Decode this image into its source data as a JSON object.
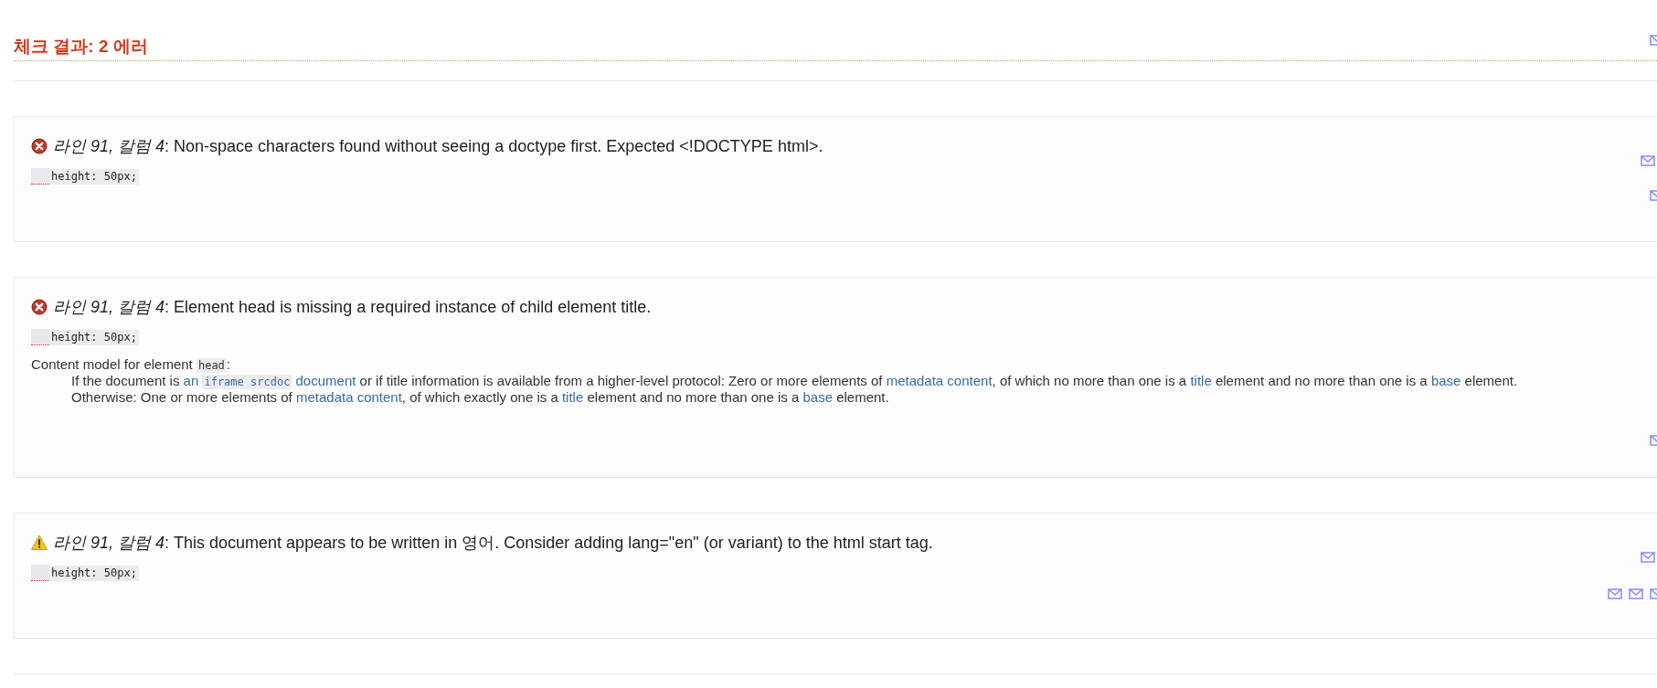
{
  "heading": "체크 결과: 2 에러",
  "messages": [
    {
      "kind": "error",
      "text": "*라인 91, 칼럼 4*: Non-space characters found without seeing a doctype first. Expected <!DOCTYPE html>.",
      "code": "height: 50px;"
    },
    {
      "kind": "error",
      "text": "*라인 91, 칼럼 4*: Element head is missing a required instance of child element title.",
      "code": "height: 50px;",
      "details": {
        "intro": [
          {
            "t": "Content model for element ",
            "kind": "plain"
          },
          {
            "t": "head",
            "kind": "code"
          },
          {
            "t": ":",
            "kind": "plain"
          }
        ],
        "lines": [
          [
            {
              "t": "If the document is ",
              "kind": "plain"
            },
            {
              "t": "an ",
              "kind": "link"
            },
            {
              "t": "iframe srcdoc",
              "kind": "codelink"
            },
            {
              "t": " document",
              "kind": "link"
            },
            {
              "t": " or if title information is available from a higher-level protocol: Zero or more elements of ",
              "kind": "plain"
            },
            {
              "t": "metadata content",
              "kind": "link"
            },
            {
              "t": ", of which no more than one is a ",
              "kind": "plain"
            },
            {
              "t": "title",
              "kind": "link"
            },
            {
              "t": " element and no more than one is a ",
              "kind": "plain"
            },
            {
              "t": "base",
              "kind": "link"
            },
            {
              "t": " element.",
              "kind": "plain"
            }
          ],
          [
            {
              "t": "Otherwise: One or more elements of ",
              "kind": "plain"
            },
            {
              "t": "metadata content",
              "kind": "link"
            },
            {
              "t": ", of which exactly one is a ",
              "kind": "plain"
            },
            {
              "t": "title",
              "kind": "link"
            },
            {
              "t": " element and no more than one is a ",
              "kind": "plain"
            },
            {
              "t": "base",
              "kind": "link"
            },
            {
              "t": " element.",
              "kind": "plain"
            }
          ]
        ]
      }
    },
    {
      "kind": "warning",
      "text": "*라인 91, 칼럼 4*: This document appears to be written in 영어. Consider adding lang=\"en\" (or variant) to the html start tag.",
      "code": "height: 50px;"
    }
  ]
}
